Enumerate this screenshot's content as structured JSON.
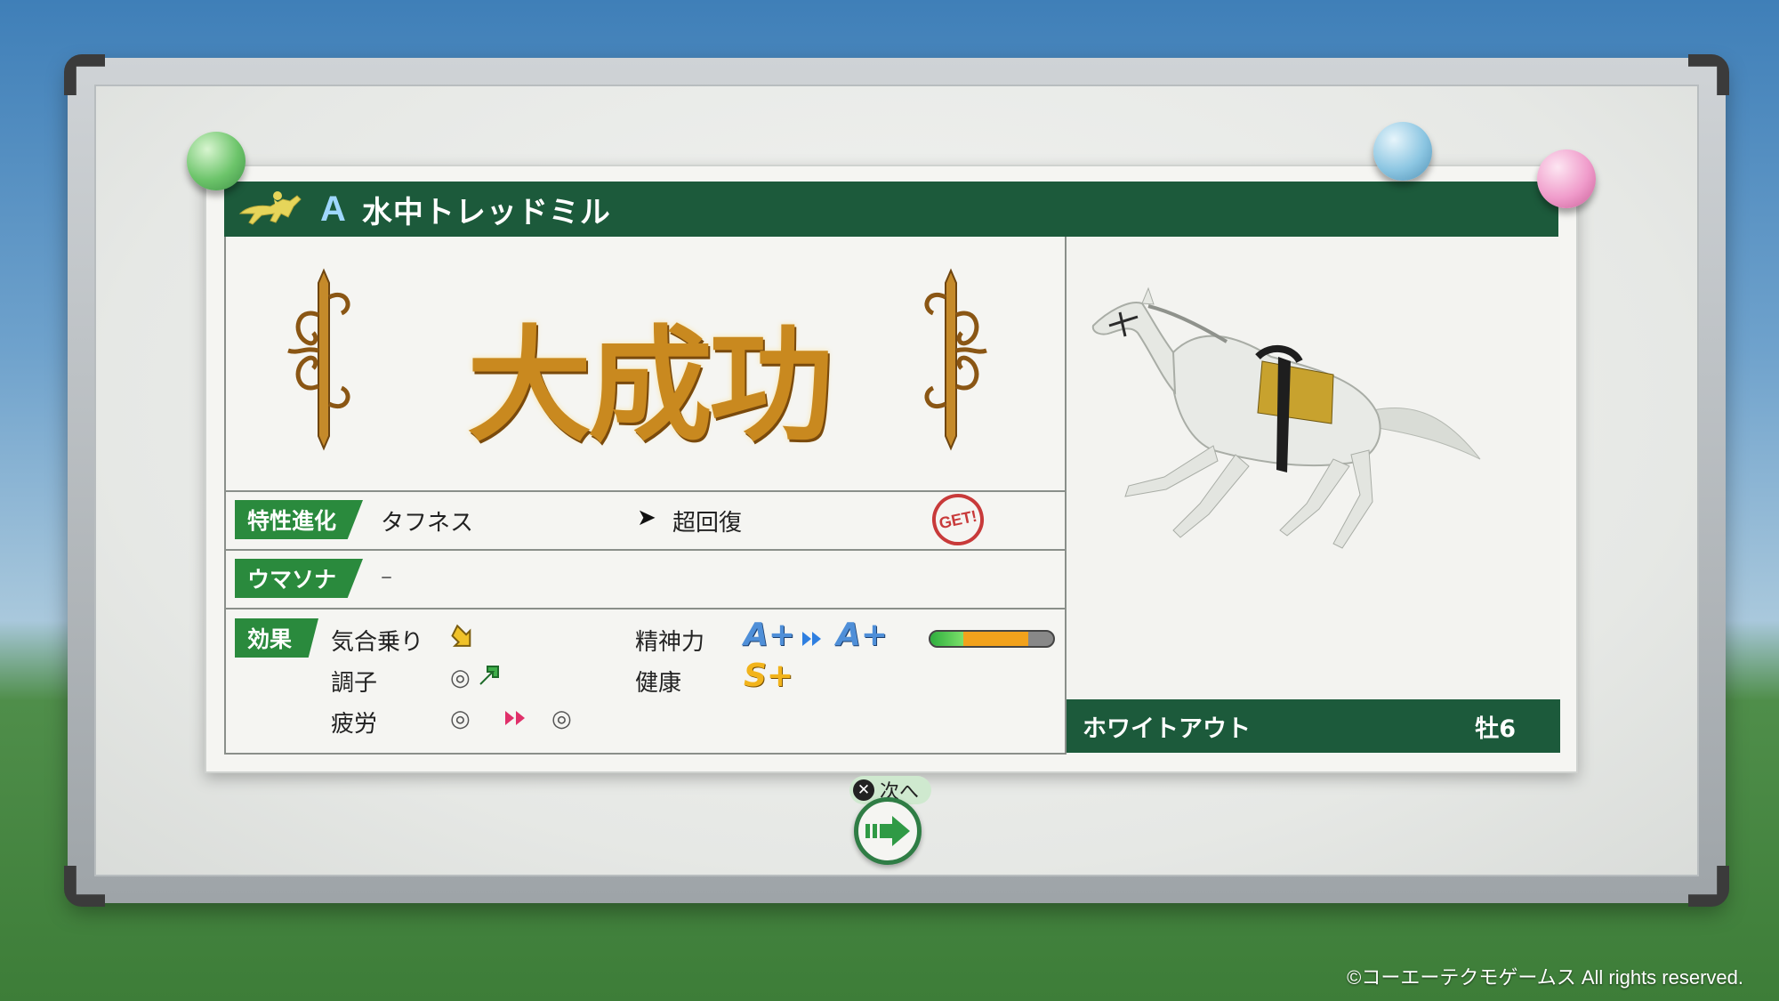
{
  "header": {
    "rank": "A",
    "title": "水中トレッドミル"
  },
  "result": {
    "text": "大成功"
  },
  "trait": {
    "tag": "特性進化",
    "from": "タフネス",
    "arrow": "➤",
    "to": "超回復",
    "badge": "GET!"
  },
  "umasona": {
    "tag": "ウマソナ",
    "value": "–"
  },
  "effect": {
    "tag": "効果",
    "motivation_label": "気合乗り",
    "condition_label": "調子",
    "condition_value": "◎",
    "fatigue_label": "疲労",
    "fatigue_from": "◎",
    "fatigue_to": "◎",
    "spirit_label": "精神力",
    "spirit_from": "A+",
    "spirit_to": "A+",
    "health_label": "健康",
    "health_value": "S+",
    "spirit_bar": {
      "green": 0.27,
      "orange": 0.53
    }
  },
  "horse": {
    "name": "ホワイトアウト",
    "sex_age": "牡6"
  },
  "next": {
    "button_glyph": "✕",
    "label": "次へ"
  },
  "copyright": "©コーエーテクモゲームス All rights reserved.",
  "colors": {
    "header_green": "#1c5a3b",
    "tag_green": "#2a8a3d",
    "gold": "#c9891f"
  },
  "icons": [
    "horse-rider-icon",
    "ornament-icon",
    "get-stamp-icon",
    "up-arrow-icon",
    "double-chevron-icon",
    "next-arrow-icon"
  ]
}
